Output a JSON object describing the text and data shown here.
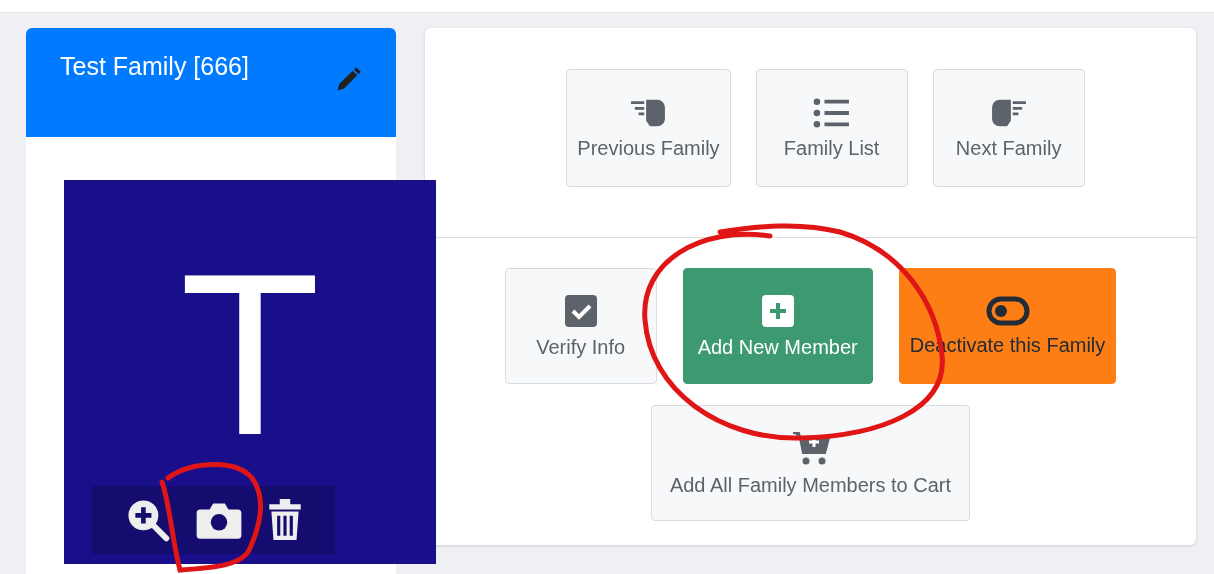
{
  "family_card": {
    "title": "Test Family [666]",
    "avatar_letter": "T",
    "avatar_tools": [
      {
        "kind": "zoom"
      },
      {
        "kind": "camera"
      },
      {
        "kind": "trash"
      }
    ]
  },
  "nav_buttons": [
    {
      "label": "Previous Family",
      "kind": "previous"
    },
    {
      "label": "Family List",
      "kind": "list"
    },
    {
      "label": "Next Family",
      "kind": "next"
    }
  ],
  "action_buttons": [
    {
      "label": "Verify Info",
      "kind": "verify"
    },
    {
      "label": "Add New Member",
      "kind": "add"
    },
    {
      "label": "Deactivate this Family",
      "kind": "deactivate"
    },
    {
      "label": "Add All Family Members to Cart",
      "kind": "cart"
    }
  ]
}
